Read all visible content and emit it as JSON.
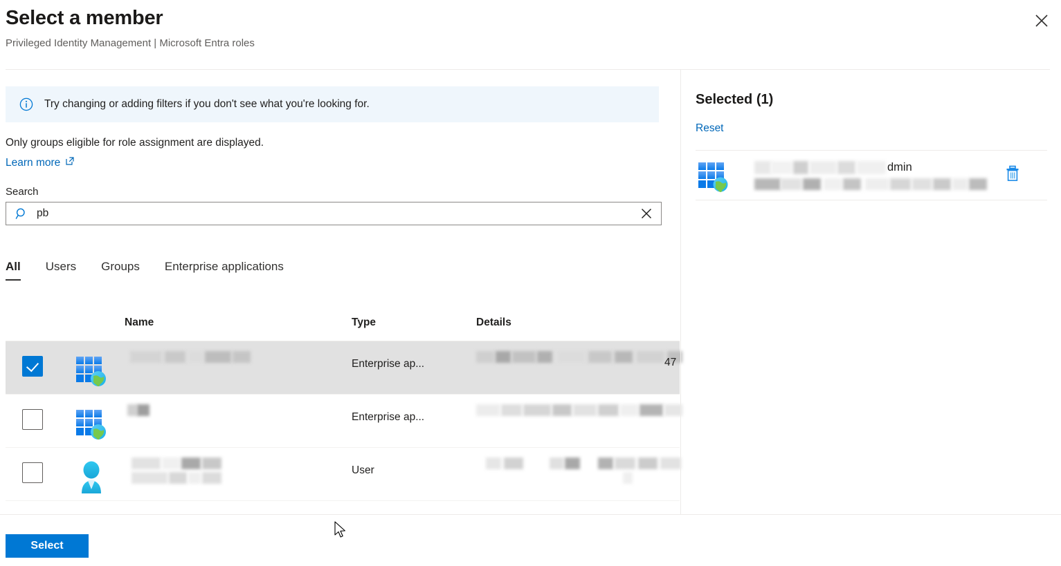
{
  "header": {
    "title": "Select a member",
    "subtitle": "Privileged Identity Management | Microsoft Entra roles",
    "close_icon": "close-icon"
  },
  "banner": {
    "icon": "info-icon",
    "text": "Try changing or adding filters if you don't see what you're looking for."
  },
  "note": {
    "text": "Only groups eligible for role assignment are displayed.",
    "link_label": "Learn more",
    "link_icon": "external-link-icon"
  },
  "search": {
    "label": "Search",
    "value": "pb",
    "placeholder": "",
    "search_icon": "search-icon",
    "clear_icon": "close-icon"
  },
  "tabs": [
    {
      "label": "All",
      "active": true
    },
    {
      "label": "Users",
      "active": false
    },
    {
      "label": "Groups",
      "active": false
    },
    {
      "label": "Enterprise applications",
      "active": false
    }
  ],
  "table": {
    "columns": [
      "Name",
      "Type",
      "Details"
    ],
    "rows": [
      {
        "checked": true,
        "selected": true,
        "icon": "enterprise-application-icon",
        "name": "",
        "type": "Enterprise ap...",
        "details": "",
        "details_suffix": "47"
      },
      {
        "checked": false,
        "selected": false,
        "icon": "enterprise-application-icon",
        "name": "",
        "type": "Enterprise ap...",
        "details": "",
        "details_suffix": ""
      },
      {
        "checked": false,
        "selected": false,
        "icon": "user-icon",
        "name": "",
        "type": "User",
        "details": "",
        "details_suffix": ""
      }
    ]
  },
  "selected_panel": {
    "title": "Selected (1)",
    "reset_label": "Reset",
    "item": {
      "icon": "enterprise-application-icon",
      "name_tail": "dmin",
      "delete_icon": "trash-icon"
    }
  },
  "footer": {
    "select_label": "Select"
  },
  "colors": {
    "accent": "#0078d4",
    "link": "#0067b8",
    "banner_bg": "#eff6fc",
    "row_selected_bg": "#e1e1e1",
    "border": "#edebe9"
  }
}
